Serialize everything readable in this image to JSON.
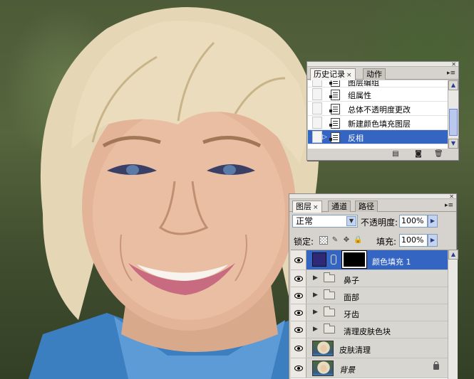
{
  "history_panel": {
    "tabs": [
      {
        "label": "历史记录",
        "close": "×",
        "active": true
      },
      {
        "label": "动作",
        "active": false
      }
    ],
    "items": [
      {
        "label": "图层编组",
        "selected": false
      },
      {
        "label": "组属性",
        "selected": false
      },
      {
        "label": "总体不透明度更改",
        "selected": false
      },
      {
        "label": "新建颜色填充图层",
        "selected": false
      },
      {
        "label": "反相",
        "selected": true
      }
    ],
    "footer_icons": [
      "new-document-icon",
      "snapshot-camera-icon",
      "trash-icon"
    ]
  },
  "layers_panel": {
    "tabs": [
      {
        "label": "图层",
        "close": "×",
        "active": true
      },
      {
        "label": "通道",
        "active": false
      },
      {
        "label": "路径",
        "active": false
      }
    ],
    "blend_mode": "正常",
    "opacity_label": "不透明度:",
    "opacity_value": "100%",
    "lock_label": "锁定:",
    "fill_label": "填充:",
    "fill_value": "100%",
    "layers": [
      {
        "name": "颜色填充 1",
        "kind": "fill",
        "fill_color": "#2e2a78",
        "selected": true,
        "visible": true
      },
      {
        "name": "鼻子",
        "kind": "group",
        "visible": true
      },
      {
        "name": "面部",
        "kind": "group",
        "visible": true
      },
      {
        "name": "牙齿",
        "kind": "group",
        "visible": true
      },
      {
        "name": "清理皮肤色块",
        "kind": "group",
        "visible": true
      },
      {
        "name": "皮肤清理",
        "kind": "image",
        "visible": true
      },
      {
        "name": "背景",
        "kind": "image",
        "visible": true,
        "locked": true
      }
    ]
  },
  "colors": {
    "selection": "#3565c2",
    "panel_bg": "#d6d3ce"
  }
}
